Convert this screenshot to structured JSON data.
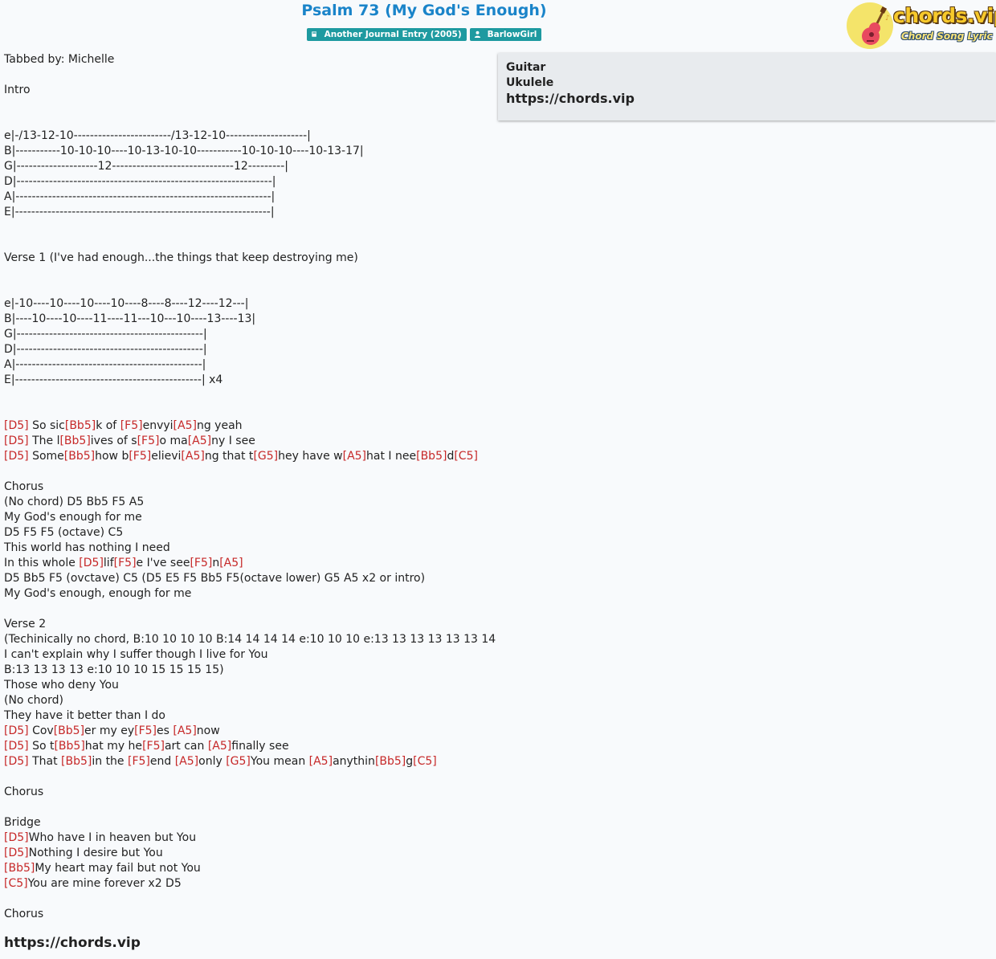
{
  "header": {
    "title": "Psalm 73 (My God's Enough)",
    "album_badge": "Another Journal Entry (2005)",
    "artist_badge": "BarlowGirl"
  },
  "logo": {
    "wordmark": "chords.vip",
    "tagline": "Chord Song Lyric"
  },
  "sidebar": {
    "guitar_label": "Guitar",
    "ukulele_label": "Ukulele",
    "site_link": "https://chords.vip"
  },
  "song": {
    "lines": [
      [
        {
          "t": "Tabbed by: Michelle"
        }
      ],
      [],
      [
        {
          "t": "Intro"
        }
      ],
      [],
      [],
      [
        {
          "t": "e|-/13-12-10------------------------/13-12-10--------------------|"
        }
      ],
      [
        {
          "t": "B|-----------10-10-10----10-13-10-10-----------10-10-10----10-13-17|"
        }
      ],
      [
        {
          "t": "G|--------------------12------------------------------12---------|"
        }
      ],
      [
        {
          "t": "D|---------------------------------------------------------------|"
        }
      ],
      [
        {
          "t": "A|---------------------------------------------------------------|"
        }
      ],
      [
        {
          "t": "E|---------------------------------------------------------------|"
        }
      ],
      [],
      [],
      [
        {
          "t": "Verse 1 (I've had enough...the things that keep destroying me)"
        }
      ],
      [],
      [],
      [
        {
          "t": "e|-10----10----10----10----8----8----12----12---|"
        }
      ],
      [
        {
          "t": "B|----10----10----11----11---10---10----13----13|"
        }
      ],
      [
        {
          "t": "G|----------------------------------------------|"
        }
      ],
      [
        {
          "t": "D|----------------------------------------------|"
        }
      ],
      [
        {
          "t": "A|----------------------------------------------|"
        }
      ],
      [
        {
          "t": "E|----------------------------------------------| x4"
        }
      ],
      [],
      [],
      [
        {
          "c": "[D5]"
        },
        {
          "t": " So sic"
        },
        {
          "c": "[Bb5]"
        },
        {
          "t": "k of "
        },
        {
          "c": "[F5]"
        },
        {
          "t": "envyi"
        },
        {
          "c": "[A5]"
        },
        {
          "t": "ng yeah"
        }
      ],
      [
        {
          "c": "[D5]"
        },
        {
          "t": " The l"
        },
        {
          "c": "[Bb5]"
        },
        {
          "t": "ives of s"
        },
        {
          "c": "[F5]"
        },
        {
          "t": "o ma"
        },
        {
          "c": "[A5]"
        },
        {
          "t": "ny I see"
        }
      ],
      [
        {
          "c": "[D5]"
        },
        {
          "t": " Some"
        },
        {
          "c": "[Bb5]"
        },
        {
          "t": "how b"
        },
        {
          "c": "[F5]"
        },
        {
          "t": "elievi"
        },
        {
          "c": "[A5]"
        },
        {
          "t": "ng that t"
        },
        {
          "c": "[G5]"
        },
        {
          "t": "hey have w"
        },
        {
          "c": "[A5]"
        },
        {
          "t": "hat I nee"
        },
        {
          "c": "[Bb5]"
        },
        {
          "t": "d"
        },
        {
          "c": "[C5]"
        }
      ],
      [],
      [
        {
          "t": "Chorus"
        }
      ],
      [
        {
          "t": "(No chord) D5 Bb5 F5 A5"
        }
      ],
      [
        {
          "t": "My God's enough for me"
        }
      ],
      [
        {
          "t": "D5 F5 F5 (octave) C5"
        }
      ],
      [
        {
          "t": "This world has nothing I need"
        }
      ],
      [
        {
          "t": "In this whole "
        },
        {
          "c": "[D5]"
        },
        {
          "t": "lif"
        },
        {
          "c": "[F5]"
        },
        {
          "t": "e I've see"
        },
        {
          "c": "[F5]"
        },
        {
          "t": "n"
        },
        {
          "c": "[A5]"
        }
      ],
      [
        {
          "t": "D5 Bb5 F5 (ovctave) C5 (D5 E5 F5 Bb5 F5(octave lower) G5 A5 x2 or intro)"
        }
      ],
      [
        {
          "t": "My God's enough, enough for me"
        }
      ],
      [],
      [
        {
          "t": "Verse 2"
        }
      ],
      [
        {
          "t": "(Techinically no chord, B:10 10 10 10 B:14 14 14 14 e:10 10 10 e:13 13 13 13 13 13 14"
        }
      ],
      [
        {
          "t": "I can't explain why I suffer though I live for You"
        }
      ],
      [
        {
          "t": "B:13 13 13 13 e:10 10 10 15 15 15 15)"
        }
      ],
      [
        {
          "t": "Those who deny You"
        }
      ],
      [
        {
          "t": "(No chord)"
        }
      ],
      [
        {
          "t": "They have it better than I do"
        }
      ],
      [
        {
          "c": "[D5]"
        },
        {
          "t": " Cov"
        },
        {
          "c": "[Bb5]"
        },
        {
          "t": "er my ey"
        },
        {
          "c": "[F5]"
        },
        {
          "t": "es "
        },
        {
          "c": "[A5]"
        },
        {
          "t": "now"
        }
      ],
      [
        {
          "c": "[D5]"
        },
        {
          "t": " So t"
        },
        {
          "c": "[Bb5]"
        },
        {
          "t": "hat my he"
        },
        {
          "c": "[F5]"
        },
        {
          "t": "art can "
        },
        {
          "c": "[A5]"
        },
        {
          "t": "finally see"
        }
      ],
      [
        {
          "c": "[D5]"
        },
        {
          "t": " That "
        },
        {
          "c": "[Bb5]"
        },
        {
          "t": "in the "
        },
        {
          "c": "[F5]"
        },
        {
          "t": "end "
        },
        {
          "c": "[A5]"
        },
        {
          "t": "only "
        },
        {
          "c": "[G5]"
        },
        {
          "t": "You mean "
        },
        {
          "c": "[A5]"
        },
        {
          "t": "anythin"
        },
        {
          "c": "[Bb5]"
        },
        {
          "t": "g"
        },
        {
          "c": "[C5]"
        }
      ],
      [],
      [
        {
          "t": "Chorus"
        }
      ],
      [],
      [
        {
          "t": "Bridge"
        }
      ],
      [
        {
          "c": "[D5]"
        },
        {
          "t": "Who have I in heaven but You"
        }
      ],
      [
        {
          "c": "[D5]"
        },
        {
          "t": "Nothing I desire but You"
        }
      ],
      [
        {
          "c": "[Bb5]"
        },
        {
          "t": "My heart may fail but not You"
        }
      ],
      [
        {
          "c": "[C5]"
        },
        {
          "t": "You are mine forever x2 D5"
        }
      ],
      [],
      [
        {
          "t": "Chorus"
        }
      ]
    ]
  },
  "footer": {
    "site_link": "https://chords.vip"
  },
  "colors": {
    "title": "#1a84c9",
    "badge": "#1e9aa0",
    "chord": "#c62828",
    "sidebar_bg": "#e8ebee"
  },
  "icons": {
    "album_badge": "book-icon",
    "artist_badge": "user-icon"
  }
}
